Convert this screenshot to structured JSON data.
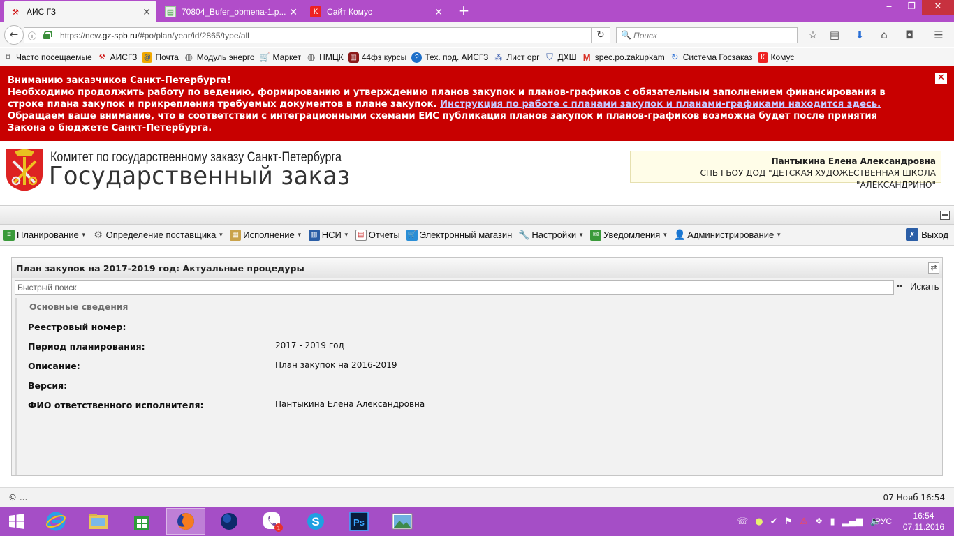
{
  "browser": {
    "tabs": [
      {
        "title": "АИС ГЗ",
        "active": true
      },
      {
        "title": "70804_Bufer_obmena-1.p...",
        "active": false
      },
      {
        "title": "Сайт Комус",
        "active": false
      }
    ],
    "url_prefix": "https://new.",
    "url_domain": "gz-spb.ru",
    "url_path": "/#po/plan/year/id/2865/type/all",
    "search_placeholder": "Поиск",
    "bookmarks": [
      {
        "label": "Часто посещаемые",
        "icon": "gear-icon"
      },
      {
        "label": "АИСГЗ",
        "icon": "aisgz-icon"
      },
      {
        "label": "Почта",
        "icon": "mail-icon"
      },
      {
        "label": "Модуль энерго",
        "icon": "globe-icon"
      },
      {
        "label": "Маркет",
        "icon": "cart-icon"
      },
      {
        "label": "НМЦК",
        "icon": "globe-icon"
      },
      {
        "label": "44фз курсы",
        "icon": "books-icon"
      },
      {
        "label": "Тех. под. АИСГЗ",
        "icon": "help-icon"
      },
      {
        "label": "Лист орг",
        "icon": "network-icon"
      },
      {
        "label": "ДХШ",
        "icon": "shield-icon"
      },
      {
        "label": "spec.po.zakupkam",
        "icon": "gmail-icon"
      },
      {
        "label": "Система Госзаказ",
        "icon": "refresh-icon"
      },
      {
        "label": "Комус",
        "icon": "komus-icon"
      }
    ]
  },
  "notice": {
    "line1": "Вниманию заказчиков Санкт-Петербурга!",
    "line2_before": "Необходимо продолжить работу по ведению, формированию и утверждению планов закупок и планов-графиков с обязательным заполнением финансирования в строке плана закупок и прикрепления требуемых документов в плане закупок. ",
    "link": "Инструкция по работе с планами закупок и планами-графиками находится здесь.",
    "line3": "Обращаем ваше внимание, что в соответствии с интеграционными схемами ЕИС публикация планов закупок и планов-графиков возможна будет после принятия Закона о бюджете Санкт-Петербурга."
  },
  "header": {
    "org_line": "Комитет по государственному заказу Санкт-Петербурга",
    "site_title": "Государственный заказ",
    "user_name": "Пантыкина Елена Александровна",
    "user_org": "СПБ ГБОУ ДОД \"ДЕТСКАЯ ХУДОЖЕСТВЕННАЯ ШКОЛА \"АЛЕКСАНДРИНО\""
  },
  "menu": {
    "items": [
      {
        "label": "Планирование",
        "dropdown": true
      },
      {
        "label": "Определение поставщика",
        "dropdown": true
      },
      {
        "label": "Исполнение",
        "dropdown": true
      },
      {
        "label": "НСИ",
        "dropdown": true
      },
      {
        "label": "Отчеты",
        "dropdown": false
      },
      {
        "label": "Электронный магазин",
        "dropdown": false
      },
      {
        "label": "Настройки",
        "dropdown": true
      },
      {
        "label": "Уведомления",
        "dropdown": true
      },
      {
        "label": "Администрирование",
        "dropdown": true
      }
    ],
    "logout": "Выход"
  },
  "panel": {
    "title": "План закупок на 2017-2019 год: Актуальные процедуры",
    "search_placeholder": "Быстрый поиск",
    "search_button": "Искать",
    "section_title": "Основные сведения",
    "fields": [
      {
        "label": "Реестровый номер:",
        "value": ""
      },
      {
        "label": "Период планирования:",
        "value": "2017 - 2019 год"
      },
      {
        "label": "Описание:",
        "value": "План закупок на 2016-2019"
      },
      {
        "label": "Версия:",
        "value": ""
      },
      {
        "label": "ФИО ответственного исполнителя:",
        "value": "Пантыкина Елена Александровна"
      }
    ]
  },
  "footer": {
    "copyright": "© ...",
    "datetime": "07 Нояб 16:54"
  },
  "taskbar": {
    "language": "РУС",
    "time": "16:54",
    "date": "07.11.2016",
    "viber_badge": "1"
  },
  "colors": {
    "tabbar": "#b14dc9",
    "notice": "#c80000",
    "taskbar": "#a54ec6"
  }
}
